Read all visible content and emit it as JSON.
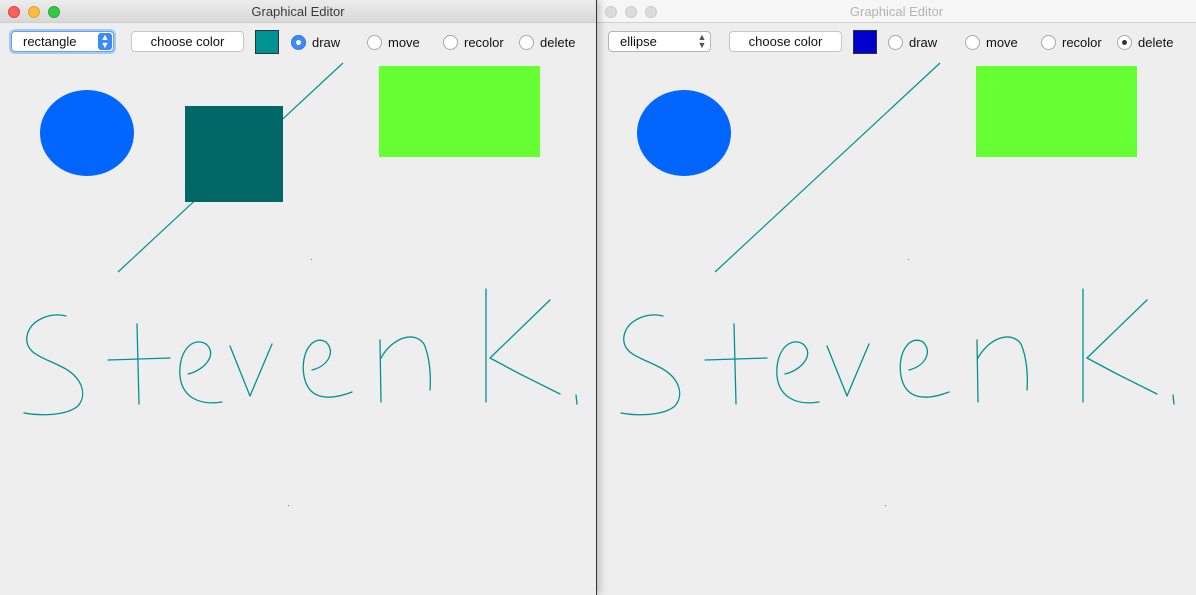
{
  "windows": [
    {
      "title": "Graphical Editor",
      "active": true,
      "shape_select": {
        "value": "rectangle"
      },
      "choose_color_label": "choose color",
      "current_color": "#009292",
      "modes": [
        {
          "label": "draw",
          "selected": true
        },
        {
          "label": "move",
          "selected": false
        },
        {
          "label": "recolor",
          "selected": false
        },
        {
          "label": "delete",
          "selected": false
        }
      ],
      "canvas_items": [
        {
          "kind": "ellipse",
          "color": "#0066ff"
        },
        {
          "kind": "line",
          "color": "#009292"
        },
        {
          "kind": "rectangle",
          "color": "#006666"
        },
        {
          "kind": "rectangle",
          "color": "#66ff33"
        },
        {
          "kind": "freehand",
          "color": "#009292",
          "text": "Steven K."
        }
      ]
    },
    {
      "title": "Graphical Editor",
      "active": false,
      "shape_select": {
        "value": "ellipse"
      },
      "choose_color_label": "choose color",
      "current_color": "#0000cc",
      "modes": [
        {
          "label": "draw",
          "selected": false
        },
        {
          "label": "move",
          "selected": false
        },
        {
          "label": "recolor",
          "selected": false
        },
        {
          "label": "delete",
          "selected": true
        }
      ],
      "canvas_items": [
        {
          "kind": "ellipse",
          "color": "#0066ff"
        },
        {
          "kind": "line",
          "color": "#009292"
        },
        {
          "kind": "rectangle",
          "color": "#66ff33"
        },
        {
          "kind": "freehand",
          "color": "#009292",
          "text": "Steven K."
        }
      ]
    }
  ]
}
